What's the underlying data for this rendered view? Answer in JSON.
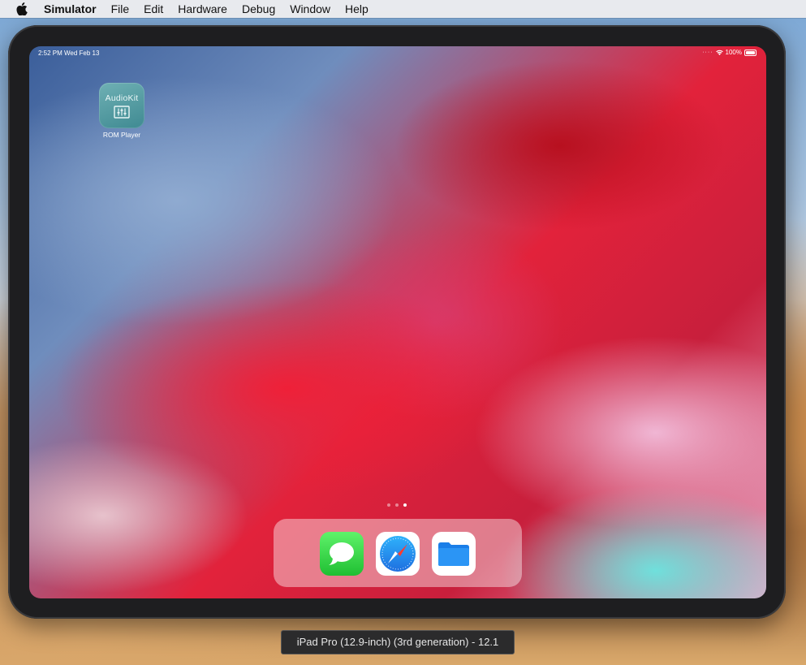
{
  "menubar": {
    "apple_icon": "apple-logo-icon",
    "app_name": "Simulator",
    "items": [
      "File",
      "Edit",
      "Hardware",
      "Debug",
      "Window",
      "Help"
    ]
  },
  "ipad": {
    "status_bar": {
      "time_date": "2:52 PM  Wed Feb 13",
      "battery_percent": "100%",
      "icons": [
        "signal-dots-icon",
        "wifi-icon",
        "battery-icon"
      ]
    },
    "apps": [
      {
        "label": "ROM Player",
        "brand_text": "AudioKit",
        "icon": "sliders-icon"
      }
    ],
    "page_dots": {
      "count": 3,
      "active_index": 2
    },
    "dock": [
      {
        "name": "Messages",
        "icon": "messages-bubble-icon"
      },
      {
        "name": "Safari",
        "icon": "safari-compass-icon"
      },
      {
        "name": "Files",
        "icon": "files-folder-icon"
      }
    ]
  },
  "tooltip": {
    "text": "iPad Pro (12.9-inch) (3rd generation) - 12.1"
  },
  "colors": {
    "menubar_bg": "#ececee",
    "device_frame": "#1e1e20",
    "audiokit_teal": "#4f9aa1",
    "messages_green": "#2ed146",
    "files_blue": "#1e88f5",
    "safari_blue": "#1f7de6"
  }
}
